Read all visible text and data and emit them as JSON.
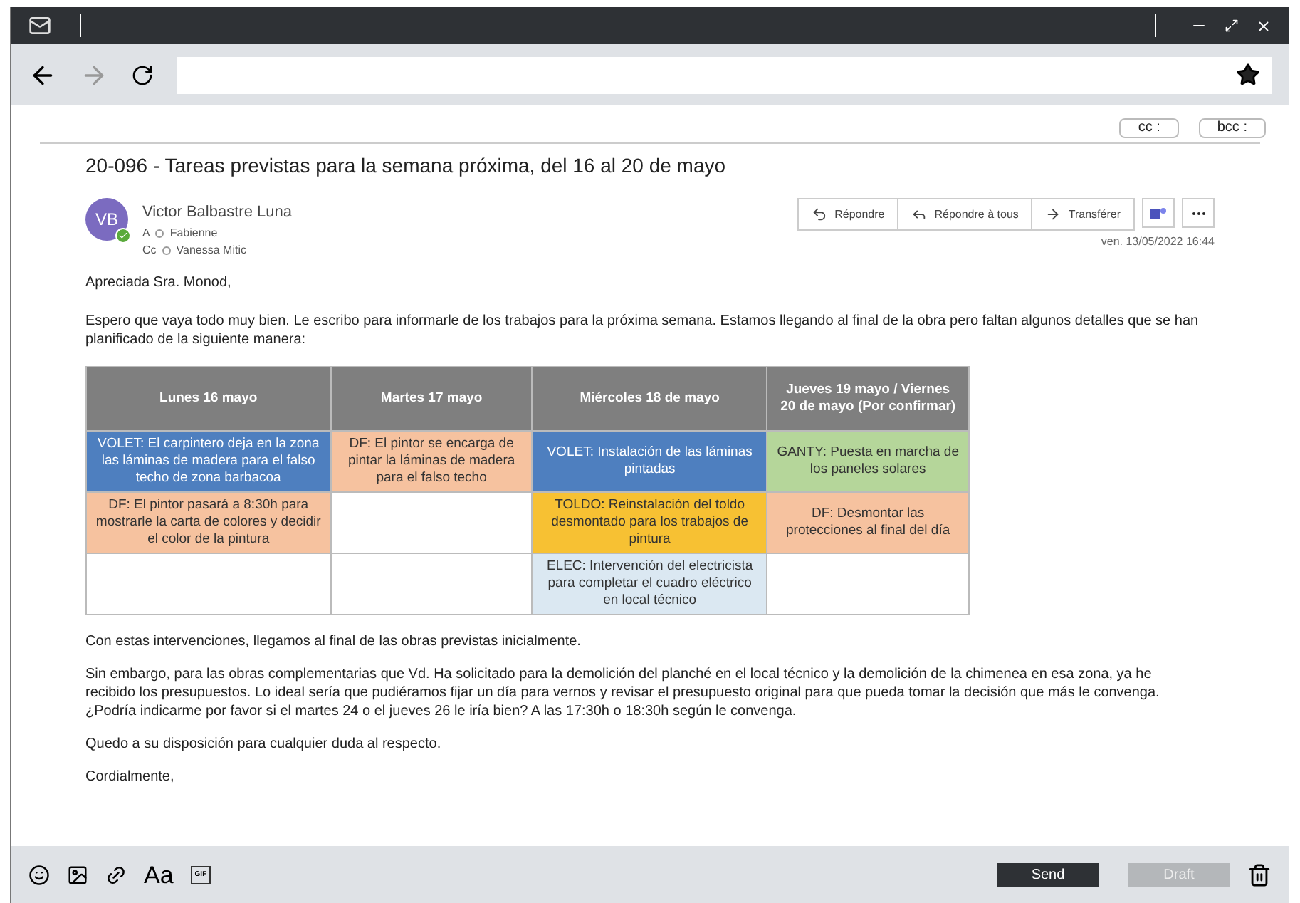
{
  "compose": {
    "cc_label": "cc :",
    "bcc_label": "bcc :"
  },
  "email": {
    "subject": "20-096 - Tareas previstas para la semana próxima, del 16 al 20 de mayo",
    "avatar": "VB",
    "online": true,
    "sender": "Victor Balbastre Luna",
    "to_label": "A",
    "to": "Fabienne",
    "cc_label": "Cc",
    "cc": "Vanessa Mitic",
    "actions": [
      {
        "kind": "reply",
        "label": "Répondre"
      },
      {
        "kind": "reply_all",
        "label": "Répondre à tous"
      },
      {
        "kind": "forward",
        "label": "Transférer"
      }
    ],
    "date": "ven. 13/05/2022 16:44",
    "greeting": "Apreciada Sra. Monod,",
    "intro": "Espero que vaya todo muy bien. Le escribo para informarle de los trabajos para la próxima semana. Estamos llegando al final de la obra pero faltan algunos detalles que se han planificado de la siguiente manera:",
    "table": {
      "columns": [
        "Lunes 16 mayo",
        "Martes 17 mayo",
        "Miércoles 18 de mayo",
        "Jueves 19 mayo / Viernes 20 de mayo (Por confirmar)"
      ],
      "rows": [
        [
          {
            "text": "VOLET: El carpintero deja en la zona las láminas de madera para el falso techo de zona barbacoa",
            "color": "#4e7fbf"
          },
          {
            "text": "DF: El pintor se encarga de pintar la láminas de madera para el falso techo",
            "color": "#f6c29f"
          },
          {
            "text": "VOLET: Instalación de las láminas pintadas",
            "color": "#4e7fbf"
          },
          {
            "text": "GANTY: Puesta en marcha de los paneles solares",
            "color": "#b5d69a"
          }
        ],
        [
          {
            "text": "DF: El pintor pasará a 8:30h para mostrarle la carta de colores y decidir el color de la pintura",
            "color": "#f6c29f"
          },
          {
            "color": "#ffffff"
          },
          {
            "text": "TOLDO: Reinstalación del toldo desmontado para los trabajos de pintura",
            "color": "#f7c133"
          },
          {
            "text": "DF: Desmontar las protecciones al final del día",
            "color": "#f6c29f"
          }
        ],
        [
          {
            "color": "#ffffff"
          },
          {
            "color": "#ffffff"
          },
          {
            "text": "ELEC: Intervención del electricista para completar el cuadro eléctrico en local técnico",
            "color": "#dbe8f2"
          },
          {
            "color": "#ffffff"
          }
        ]
      ]
    },
    "paragraphs": [
      "Con estas intervenciones, llegamos al final de las obras previstas inicialmente.",
      "Sin embargo, para las obras complementarias que Vd. Ha solicitado para la demolición del planché en el local técnico y la demolición de la chimenea en esa zona, ya he recibido los presupuestos. Lo ideal sería que pudiéramos fijar un día para vernos y revisar el presupuesto original para que pueda tomar la decisión que más le convenga. ¿Podría indicarme por favor si el martes 24 o el jueves 26 le iría bien? A las 17:30h o 18:30h según le convenga.",
      "Quedo a su disposición para cualquier duda al respecto.",
      "Cordialmente,"
    ]
  },
  "toolbar": {
    "font_label": "Aa",
    "gif_label": "GIF",
    "send": "Send",
    "draft": "Draft",
    "draft_disabled": true
  }
}
